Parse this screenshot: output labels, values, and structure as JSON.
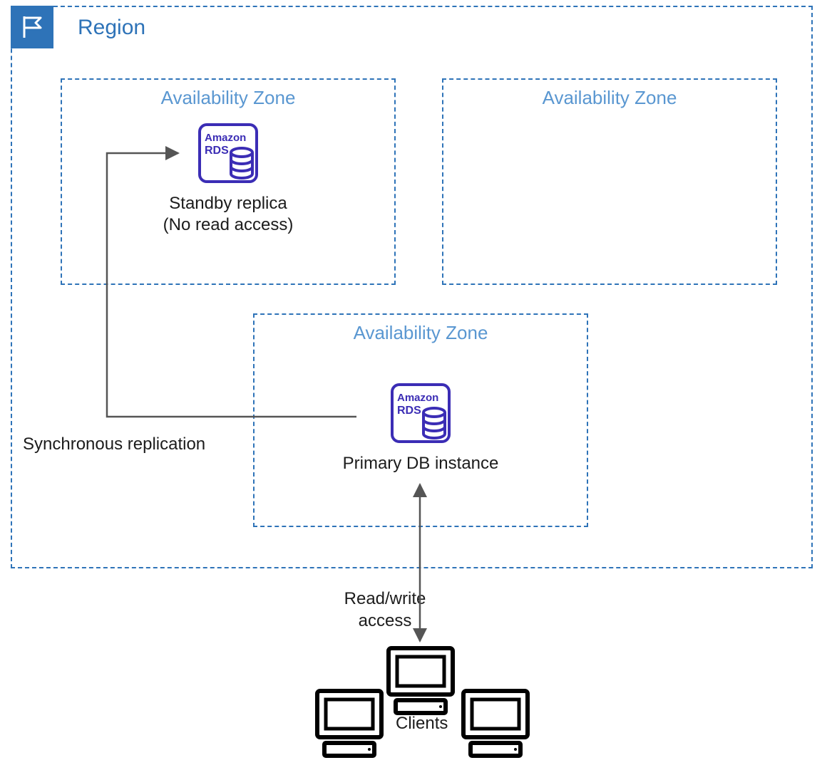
{
  "region": {
    "title": "Region"
  },
  "az1": {
    "title": "Availability Zone"
  },
  "az2": {
    "title": "Availability Zone"
  },
  "az3": {
    "title": "Availability Zone"
  },
  "standby": {
    "icon_label": "Amazon\nRDS",
    "caption_line1": "Standby replica",
    "caption_line2": "(No read access)"
  },
  "primary": {
    "icon_label": "Amazon\nRDS",
    "caption": "Primary DB instance"
  },
  "replication_label": "Synchronous replication",
  "access_label_line1": "Read/write",
  "access_label_line2": "access",
  "clients_label": "Clients"
}
